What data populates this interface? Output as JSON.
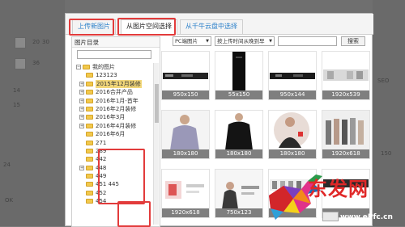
{
  "tabs": {
    "upload": "上传新图片",
    "space": "从图片空间选择",
    "qianniu": "从千牛云盘中选择"
  },
  "tree": {
    "header": "图片目录",
    "search_value": "",
    "root": "我的图片",
    "nodes": [
      "123123",
      "2015年12月装修",
      "2016合并产品",
      "2016年1月-首年",
      "2016年2月装修",
      "2016年3月",
      "2016年4月装修",
      "2016年6月",
      "271",
      "289",
      "442",
      "448",
      "449",
      "451 445",
      "452",
      "454"
    ]
  },
  "filter": {
    "source": "PC端图片",
    "sort": "按上传时间从晚到早",
    "search_value": "",
    "search_btn": "搜索"
  },
  "images": [
    {
      "size": "950x150",
      "kind": "banner-dark"
    },
    {
      "size": "55x150",
      "kind": "tall-dark"
    },
    {
      "size": "950x144",
      "kind": "banner-dark"
    },
    {
      "size": "1920x539",
      "kind": "banner-light"
    },
    {
      "size": "180x180",
      "kind": "model-woman"
    },
    {
      "size": "180x180",
      "kind": "black-tee"
    },
    {
      "size": "180x180",
      "kind": "model-circle"
    },
    {
      "size": "1920x618",
      "kind": "group-models"
    },
    {
      "size": "1920x618",
      "kind": "banner-red"
    },
    {
      "size": "750x123",
      "kind": "banner-woman"
    },
    {
      "size": "",
      "kind": "strip-light"
    },
    {
      "size": "",
      "kind": "banner-dark"
    }
  ],
  "background": {
    "labels": [
      "20",
      "36",
      "30",
      "14",
      "15",
      "SEO",
      "150",
      "24",
      "OK"
    ]
  },
  "watermark": {
    "text": "东发网",
    "url": "www.ePfc.cn"
  },
  "colors": {
    "highlight": "#e23b3b",
    "tab_blue": "#2a7fc9",
    "caption_bg": "#7f7f7f",
    "folder": "#f2c94c"
  }
}
